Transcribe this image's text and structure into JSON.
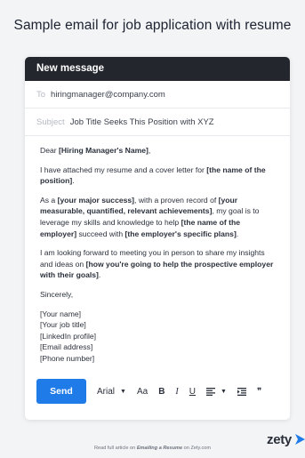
{
  "page_title": "Sample email for job application with resume",
  "window": {
    "title": "New message"
  },
  "to": {
    "label": "To",
    "value": "hiringmanager@company.com"
  },
  "subject": {
    "label": "Subject",
    "value": "Job Title Seeks This Position with XYZ"
  },
  "body": {
    "greeting_prefix": "Dear ",
    "greeting_bold": "[Hiring Manager's Name]",
    "greeting_suffix": ",",
    "p1_text": "I have attached my resume and a cover letter for ",
    "p1_bold": "[the name of the position]",
    "p1_end": ".",
    "p2_a": "As a ",
    "p2_b_bold": "[your major success]",
    "p2_c": ", with a proven record of ",
    "p2_d_bold": "[your measurable, quantified, relevant achievements]",
    "p2_e": ", my goal is to leverage my skills and knowledge to help ",
    "p2_f_bold": "[the name of the employer]",
    "p2_g": " succeed with ",
    "p2_h_bold": "[the employer's specific plans]",
    "p2_i": ".",
    "p3_a": "I am looking forward to meeting you in person to share my insights and ideas on ",
    "p3_b_bold": "[how you're going to help the prospective employer with their goals]",
    "p3_c": ".",
    "closing": "Sincerely,",
    "signature": [
      "[Your name]",
      "[Your job title]",
      "[LinkedIn profile]",
      "[Email address]",
      "[Phone number]"
    ]
  },
  "toolbar": {
    "send_label": "Send",
    "font_label": "Arial",
    "font_size_label": "Aa",
    "bold_label": "B",
    "italic_label": "I",
    "underline_label": "U",
    "quote_label": "❞"
  },
  "footer": {
    "prefix": "Read full article on ",
    "link_text": "Emailing a Resume",
    "suffix": " on Zety.com"
  },
  "brand": {
    "logo_text": "zety",
    "accent": "#1f7be8"
  },
  "icons": {
    "font_caret": "chevron-down-icon",
    "align": "align-left-icon",
    "indent": "indent-icon",
    "quote": "quote-icon"
  }
}
